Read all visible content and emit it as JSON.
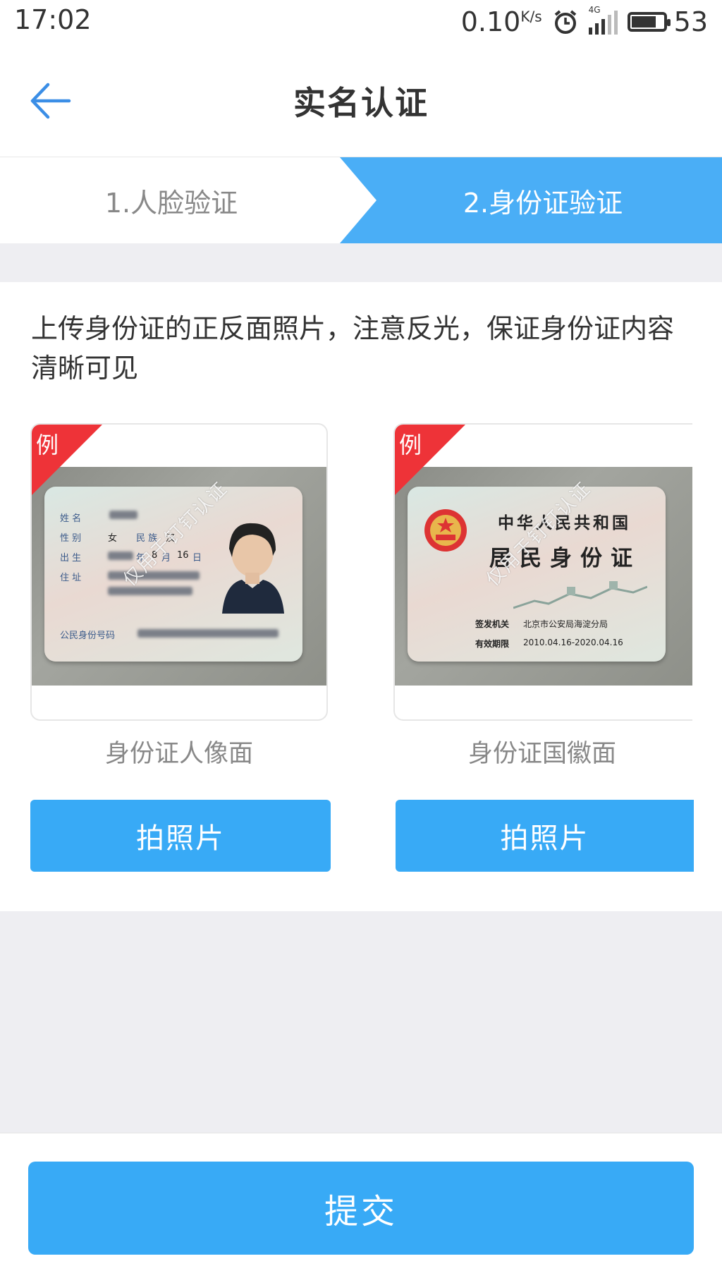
{
  "status": {
    "time": "17:02",
    "speed": "0.10",
    "speed_unit": "K/s",
    "network": "4G",
    "battery": "53"
  },
  "header": {
    "title": "实名认证"
  },
  "steps": [
    {
      "label": "1.人脸验证",
      "active": false
    },
    {
      "label": "2.身份证验证",
      "active": true
    }
  ],
  "instruction": "上传身份证的正反面照片，注意反光，保证身份证内容清晰可见",
  "cards": [
    {
      "badge": "例",
      "caption": "身份证人像面",
      "button": "拍照片",
      "watermark": "仅用于钉钉认证",
      "fields": {
        "name": "姓 名",
        "gender": "性 别",
        "gender_value": "女",
        "ethnic": "民 族",
        "ethnic_value": "汉",
        "birth": "出 生",
        "birth_year": "年",
        "birth_month": "8",
        "birth_month_unit": "月",
        "birth_day": "16",
        "birth_day_unit": "日",
        "address": "住 址",
        "id_number": "公民身份号码"
      }
    },
    {
      "badge": "例",
      "caption": "身份证国徽面",
      "button": "拍照片",
      "watermark": "仅用于钉钉认证",
      "fields": {
        "country": "中华人民共和国",
        "title": "居民身份证",
        "issuer_label": "签发机关",
        "issuer": "北京市公安局海淀分局",
        "validity_label": "有效期限",
        "validity": "2010.04.16-2020.04.16"
      }
    }
  ],
  "submit": "提交",
  "colors": {
    "accent": "#38aaf6",
    "badge": "#ee3338"
  }
}
